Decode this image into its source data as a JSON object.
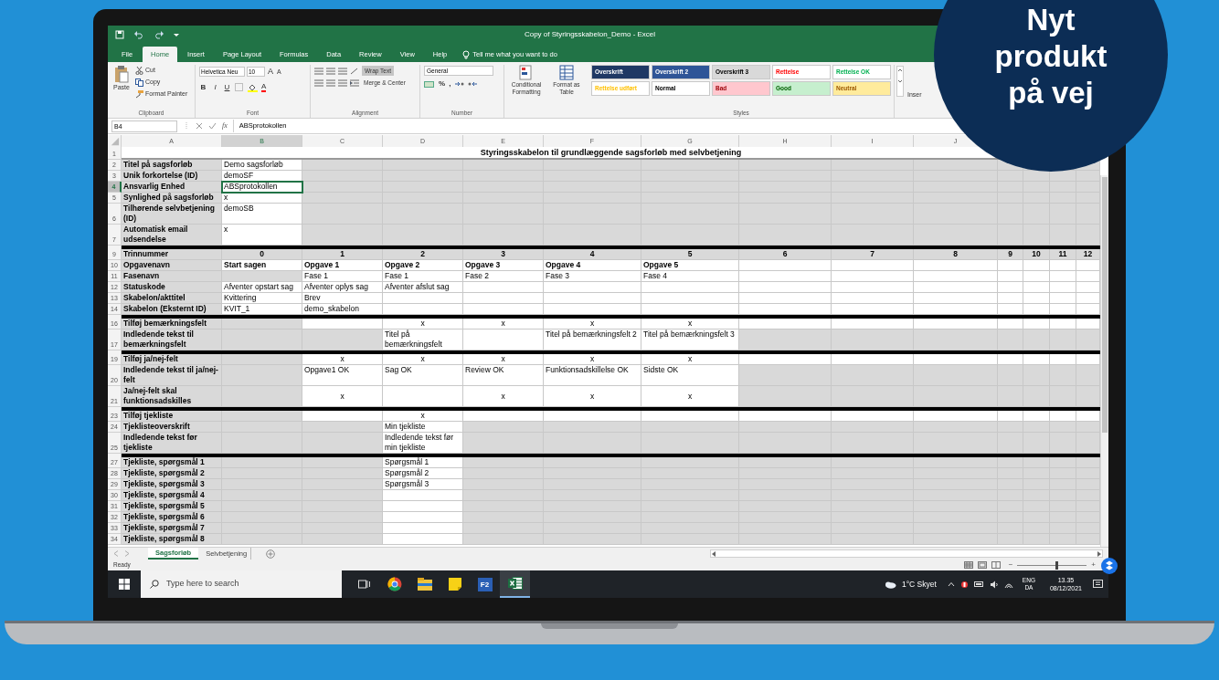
{
  "badge": {
    "text": "Nyt produkt på vej"
  },
  "title_bar": {
    "title": "Copy of Styringsskabelon_Demo  -  Excel"
  },
  "ribbon_tabs": [
    {
      "label": "File",
      "selected": false
    },
    {
      "label": "Home",
      "selected": true
    },
    {
      "label": "Insert",
      "selected": false
    },
    {
      "label": "Page Layout",
      "selected": false
    },
    {
      "label": "Formulas",
      "selected": false
    },
    {
      "label": "Data",
      "selected": false
    },
    {
      "label": "Review",
      "selected": false
    },
    {
      "label": "View",
      "selected": false
    },
    {
      "label": "Help",
      "selected": false
    }
  ],
  "tell_me": "Tell me what you want to do",
  "ribbon": {
    "clipboard": {
      "label": "Clipboard",
      "paste": "Paste",
      "cut": "Cut",
      "copy": "Copy",
      "format_painter": "Format Painter"
    },
    "font": {
      "label": "Font",
      "font_name": "Helvetica Neu",
      "font_size": "10",
      "size_buttons": [
        "A",
        "A"
      ],
      "format_buttons": [
        "B",
        "I",
        "U"
      ],
      "color_button": "A"
    },
    "alignment": {
      "label": "Alignment",
      "wrap_text": {
        "label": "Wrap Text",
        "on": true
      },
      "merge": "Merge & Center"
    },
    "number": {
      "label": "Number",
      "format": "General",
      "symbols": [
        "%",
        ","
      ]
    },
    "commands": [
      "Conditional Formatting",
      "Format as Table"
    ],
    "styles": {
      "label": "Styles",
      "tiles": [
        {
          "text": "Overskrift",
          "color": "#1f3864",
          "kind": "heading"
        },
        {
          "text": "Overskrift 2",
          "color": "#2f5597",
          "kind": "heading"
        },
        {
          "text": "Overskrift 3",
          "color": "#d9d9d9",
          "kind": "plain"
        },
        {
          "text": "Rettelse",
          "color": "#ffffff",
          "kind": "red"
        },
        {
          "text": "Rettelse OK",
          "color": "#ffffff",
          "kind": "green"
        },
        {
          "text": "Rettelse udført",
          "color": "#ffffff",
          "kind": "orange"
        },
        {
          "text": "Normal",
          "color": "#ffffff",
          "kind": "plain"
        },
        {
          "text": "Bad",
          "color": "#ffc7ce",
          "kind": "bad"
        },
        {
          "text": "Good",
          "color": "#c6efce",
          "kind": "good"
        },
        {
          "text": "Neutral",
          "color": "#ffeb9c",
          "kind": "neutral"
        }
      ]
    },
    "cut_command": "Inser"
  },
  "formula_bar": {
    "name_box": "B4",
    "fx": "fx",
    "formula": "ABSprotokollen"
  },
  "grid": {
    "columns": [
      {
        "label": "A",
        "selected": false
      },
      {
        "label": "B",
        "selected": true
      },
      {
        "label": "C",
        "selected": false
      },
      {
        "label": "D",
        "selected": false
      },
      {
        "label": "E",
        "selected": false
      },
      {
        "label": "F",
        "selected": false
      },
      {
        "label": "G",
        "selected": false
      },
      {
        "label": "H",
        "selected": false
      },
      {
        "label": "I",
        "selected": false
      },
      {
        "label": "J",
        "selected": false
      }
    ],
    "rows": [
      {
        "number": "1",
        "kind": "title",
        "selected": false,
        "text": "Styringsskabelon til grundlæggende sagsforløb med selvbetjening"
      },
      {
        "number": "2",
        "kind": "normal",
        "selected": false,
        "cells": [
          {
            "text": "Titel på sagsforløb",
            "shaded": true
          },
          {
            "text": "Demo sagsforløb",
            "shaded": false
          },
          {
            "shaded": true
          },
          {
            "shaded": true
          },
          {
            "shaded": true
          },
          {
            "shaded": true
          },
          {
            "shaded": true
          },
          {
            "shaded": true
          },
          {
            "shaded": true
          },
          {
            "shaded": true
          },
          {
            "shaded": true
          },
          {
            "shaded": true
          },
          {
            "shaded": true
          },
          {
            "shaded": true
          }
        ]
      },
      {
        "number": "3",
        "kind": "normal",
        "selected": false,
        "cells": [
          {
            "text": "Unik forkortelse (ID)",
            "shaded": true
          },
          {
            "text": "demoSF",
            "shaded": false
          },
          {
            "shaded": true
          },
          {
            "shaded": true
          },
          {
            "shaded": true
          },
          {
            "shaded": true
          },
          {
            "shaded": true
          },
          {
            "shaded": true
          },
          {
            "shaded": true
          },
          {
            "shaded": true
          },
          {
            "shaded": true
          },
          {
            "shaded": true
          },
          {
            "shaded": true
          },
          {
            "shaded": true
          }
        ]
      },
      {
        "number": "4",
        "kind": "normal",
        "selected": true,
        "cells": [
          {
            "text": "Ansvarlig Enhed",
            "shaded": true
          },
          {
            "text": "ABSprotokollen",
            "shaded": false
          },
          {
            "shaded": true
          },
          {
            "shaded": true
          },
          {
            "shaded": true
          },
          {
            "shaded": true
          },
          {
            "shaded": true
          },
          {
            "shaded": true
          },
          {
            "shaded": true
          },
          {
            "shaded": true
          },
          {
            "shaded": true
          },
          {
            "shaded": true
          },
          {
            "shaded": true
          },
          {
            "shaded": true
          }
        ]
      },
      {
        "number": "5",
        "kind": "normal",
        "selected": false,
        "cells": [
          {
            "text": "Synlighed på sagsforløb",
            "shaded": true
          },
          {
            "text": "x",
            "shaded": false
          },
          {
            "shaded": true
          },
          {
            "shaded": true
          },
          {
            "shaded": true
          },
          {
            "shaded": true
          },
          {
            "shaded": true
          },
          {
            "shaded": true
          },
          {
            "shaded": true
          },
          {
            "shaded": true
          },
          {
            "shaded": true
          },
          {
            "shaded": true
          },
          {
            "shaded": true
          },
          {
            "shaded": true
          }
        ]
      },
      {
        "number": "6",
        "kind": "normal",
        "selected": false,
        "cells": [
          {
            "text": "Tilhørende selvbetjening (ID)",
            "shaded": true
          },
          {
            "text": "demoSB",
            "shaded": false
          },
          {
            "shaded": true
          },
          {
            "shaded": true
          },
          {
            "shaded": true
          },
          {
            "shaded": true
          },
          {
            "shaded": true
          },
          {
            "shaded": true
          },
          {
            "shaded": true
          },
          {
            "shaded": true
          },
          {
            "shaded": true
          },
          {
            "shaded": true
          },
          {
            "shaded": true
          },
          {
            "shaded": true
          }
        ]
      },
      {
        "number": "7",
        "kind": "normal",
        "selected": false,
        "cells": [
          {
            "text": "Automatisk email udsendelse",
            "shaded": true
          },
          {
            "text": "x",
            "shaded": false
          },
          {
            "shaded": true
          },
          {
            "shaded": true
          },
          {
            "shaded": true
          },
          {
            "shaded": true
          },
          {
            "shaded": true
          },
          {
            "shaded": true
          },
          {
            "shaded": true
          },
          {
            "shaded": true
          },
          {
            "shaded": true
          },
          {
            "shaded": true
          },
          {
            "shaded": true
          },
          {
            "shaded": true
          }
        ]
      },
      {
        "kind": "separator"
      },
      {
        "number": "9",
        "kind": "steps",
        "selected": false,
        "cells": [
          {
            "text": "Trinnummer",
            "shaded": true
          },
          {
            "text": "0",
            "shaded": true
          },
          {
            "text": "1",
            "shaded": true
          },
          {
            "text": "2",
            "shaded": true
          },
          {
            "text": "3",
            "shaded": true
          },
          {
            "text": "4",
            "shaded": true
          },
          {
            "text": "5",
            "shaded": true
          },
          {
            "text": "6",
            "shaded": true
          },
          {
            "text": "7",
            "shaded": true
          },
          {
            "text": "8",
            "shaded": true
          },
          {
            "text": "9",
            "shaded": true
          },
          {
            "text": "10",
            "shaded": true
          },
          {
            "text": "11",
            "shaded": true
          },
          {
            "text": "12",
            "shaded": true
          }
        ]
      },
      {
        "number": "10",
        "kind": "bold",
        "selected": false,
        "cells": [
          {
            "text": "Opgavenavn",
            "shaded": true
          },
          {
            "text": "Start sagen",
            "shaded": false
          },
          {
            "text": "Opgave 1",
            "shaded": false
          },
          {
            "text": "Opgave 2",
            "shaded": false
          },
          {
            "text": "Opgave 3",
            "shaded": false
          },
          {
            "text": "Opgave 4",
            "shaded": false
          },
          {
            "text": "Opgave 5",
            "shaded": false
          },
          {
            "shaded": false
          },
          {
            "shaded": false
          },
          {
            "shaded": false
          },
          {
            "shaded": false
          },
          {
            "shaded": false
          },
          {
            "shaded": false
          },
          {
            "shaded": false
          }
        ]
      },
      {
        "number": "11",
        "kind": "normal",
        "selected": false,
        "cells": [
          {
            "text": "Fasenavn",
            "shaded": true
          },
          {
            "shaded": true
          },
          {
            "text": "Fase 1",
            "shaded": false
          },
          {
            "text": "Fase 1",
            "shaded": false
          },
          {
            "text": "Fase 2",
            "shaded": false
          },
          {
            "text": "Fase 3",
            "shaded": false
          },
          {
            "text": "Fase 4",
            "shaded": false
          },
          {
            "shaded": false
          },
          {
            "shaded": false
          },
          {
            "shaded": false
          },
          {
            "shaded": false
          },
          {
            "shaded": false
          },
          {
            "shaded": false
          },
          {
            "shaded": false
          }
        ]
      },
      {
        "number": "12",
        "kind": "normal",
        "selected": false,
        "cells": [
          {
            "text": "Statuskode",
            "shaded": true
          },
          {
            "text": "Afventer opstart sag",
            "shaded": false
          },
          {
            "text": "Afventer oplys sag",
            "shaded": false
          },
          {
            "text": "Afventer afslut sag",
            "shaded": false
          },
          {
            "shaded": false
          },
          {
            "shaded": false
          },
          {
            "shaded": false
          },
          {
            "shaded": false
          },
          {
            "shaded": false
          },
          {
            "shaded": false
          },
          {
            "shaded": false
          },
          {
            "shaded": false
          },
          {
            "shaded": false
          },
          {
            "shaded": false
          }
        ]
      },
      {
        "number": "13",
        "kind": "normal",
        "selected": false,
        "cells": [
          {
            "text": "Skabelon/akttitel",
            "shaded": true
          },
          {
            "text": "Kvittering",
            "shaded": false
          },
          {
            "text": "Brev",
            "shaded": false
          },
          {
            "shaded": false
          },
          {
            "shaded": false
          },
          {
            "shaded": false
          },
          {
            "shaded": false
          },
          {
            "shaded": false
          },
          {
            "shaded": false
          },
          {
            "shaded": false
          },
          {
            "shaded": false
          },
          {
            "shaded": false
          },
          {
            "shaded": false
          },
          {
            "shaded": false
          }
        ]
      },
      {
        "number": "14",
        "kind": "normal",
        "selected": false,
        "cells": [
          {
            "text": "Skabelon (Eksternt ID)",
            "shaded": true
          },
          {
            "text": "KVIT_1",
            "shaded": false
          },
          {
            "text": "demo_skabelon",
            "shaded": false
          },
          {
            "shaded": false
          },
          {
            "shaded": false
          },
          {
            "shaded": false
          },
          {
            "shaded": false
          },
          {
            "shaded": false
          },
          {
            "shaded": false
          },
          {
            "shaded": false
          },
          {
            "shaded": false
          },
          {
            "shaded": false
          },
          {
            "shaded": false
          },
          {
            "shaded": false
          }
        ]
      },
      {
        "kind": "separator"
      },
      {
        "number": "16",
        "kind": "normal",
        "selected": false,
        "cells": [
          {
            "text": "Tilføj bemærkningsfelt",
            "shaded": true
          },
          {
            "shaded": true
          },
          {
            "shaded": false
          },
          {
            "text": "x",
            "kind": "mark",
            "shaded": false
          },
          {
            "text": "x",
            "kind": "mark",
            "shaded": false
          },
          {
            "text": "x",
            "kind": "mark",
            "shaded": false
          },
          {
            "text": "x",
            "kind": "mark",
            "shaded": false
          },
          {
            "shaded": false
          },
          {
            "shaded": false
          },
          {
            "shaded": false
          },
          {
            "shaded": false
          },
          {
            "shaded": false
          },
          {
            "shaded": false
          },
          {
            "shaded": false
          }
        ]
      },
      {
        "number": "17",
        "kind": "normal",
        "selected": false,
        "cells": [
          {
            "text": "Indledende tekst til bemærkningsfelt",
            "shaded": true
          },
          {
            "shaded": true
          },
          {
            "shaded": true
          },
          {
            "text": "Titel på bemærkningsfelt",
            "shaded": false
          },
          {
            "shaded": false
          },
          {
            "text": "Titel på bemærkningsfelt 2",
            "shaded": false
          },
          {
            "text": "Titel på bemærkningsfelt 3",
            "shaded": false
          },
          {
            "shaded": true
          },
          {
            "shaded": true
          },
          {
            "shaded": true
          },
          {
            "shaded": true
          },
          {
            "shaded": true
          },
          {
            "shaded": true
          },
          {
            "shaded": true
          }
        ]
      },
      {
        "kind": "separator"
      },
      {
        "number": "19",
        "kind": "normal",
        "selected": false,
        "cells": [
          {
            "text": "Tilføj ja/nej-felt",
            "shaded": true
          },
          {
            "shaded": true
          },
          {
            "text": "x",
            "kind": "mark",
            "shaded": false
          },
          {
            "text": "x",
            "kind": "mark",
            "shaded": false
          },
          {
            "text": "x",
            "kind": "mark",
            "shaded": false
          },
          {
            "text": "x",
            "kind": "mark",
            "shaded": false
          },
          {
            "text": "x",
            "kind": "mark",
            "shaded": false
          },
          {
            "shaded": false
          },
          {
            "shaded": false
          },
          {
            "shaded": false
          },
          {
            "shaded": false
          },
          {
            "shaded": false
          },
          {
            "shaded": false
          },
          {
            "shaded": false
          }
        ]
      },
      {
        "number": "20",
        "kind": "normal",
        "selected": false,
        "cells": [
          {
            "text": "Indledende tekst til ja/nej-felt",
            "shaded": true
          },
          {
            "shaded": true
          },
          {
            "text": "Opgave1 OK",
            "shaded": false
          },
          {
            "text": "Sag OK",
            "shaded": false
          },
          {
            "text": "Review OK",
            "shaded": false
          },
          {
            "text": "Funktionsadskillelse OK",
            "shaded": false
          },
          {
            "text": "Sidste OK",
            "shaded": false
          },
          {
            "shaded": true
          },
          {
            "shaded": true
          },
          {
            "shaded": true
          },
          {
            "shaded": true
          },
          {
            "shaded": true
          },
          {
            "shaded": true
          },
          {
            "shaded": true
          }
        ]
      },
      {
        "number": "21",
        "kind": "normal",
        "selected": false,
        "cells": [
          {
            "text": "Ja/nej-felt skal funktionsadskilles",
            "shaded": true
          },
          {
            "shaded": true
          },
          {
            "text": "x",
            "kind": "mark",
            "shaded": false
          },
          {
            "shaded": false
          },
          {
            "text": "x",
            "kind": "mark",
            "shaded": false
          },
          {
            "text": "x",
            "kind": "mark",
            "shaded": false
          },
          {
            "text": "x",
            "kind": "mark",
            "shaded": false
          },
          {
            "shaded": true
          },
          {
            "shaded": true
          },
          {
            "shaded": true
          },
          {
            "shaded": true
          },
          {
            "shaded": true
          },
          {
            "shaded": true
          },
          {
            "shaded": true
          }
        ]
      },
      {
        "kind": "separator"
      },
      {
        "number": "23",
        "kind": "normal",
        "selected": false,
        "cells": [
          {
            "text": "Tilføj tjekliste",
            "shaded": true
          },
          {
            "shaded": true
          },
          {
            "shaded": false
          },
          {
            "text": "x",
            "kind": "mark",
            "shaded": false
          },
          {
            "shaded": false
          },
          {
            "shaded": false
          },
          {
            "shaded": false
          },
          {
            "shaded": false
          },
          {
            "shaded": false
          },
          {
            "shaded": false
          },
          {
            "shaded": false
          },
          {
            "shaded": false
          },
          {
            "shaded": false
          },
          {
            "shaded": false
          }
        ]
      },
      {
        "number": "24",
        "kind": "normal",
        "selected": false,
        "cells": [
          {
            "text": "Tjeklisteoverskrift",
            "shaded": true
          },
          {
            "shaded": true
          },
          {
            "shaded": true
          },
          {
            "text": "Min tjekliste",
            "shaded": false
          },
          {
            "shaded": true
          },
          {
            "shaded": true
          },
          {
            "shaded": true
          },
          {
            "shaded": true
          },
          {
            "shaded": true
          },
          {
            "shaded": true
          },
          {
            "shaded": true
          },
          {
            "shaded": true
          },
          {
            "shaded": true
          },
          {
            "shaded": true
          }
        ]
      },
      {
        "number": "25",
        "kind": "normal",
        "selected": false,
        "cells": [
          {
            "text": "Indledende tekst før tjekliste",
            "shaded": true
          },
          {
            "shaded": true
          },
          {
            "shaded": true
          },
          {
            "text": "Indledende tekst før min tjekliste",
            "shaded": false
          },
          {
            "shaded": true
          },
          {
            "shaded": true
          },
          {
            "shaded": true
          },
          {
            "shaded": true
          },
          {
            "shaded": true
          },
          {
            "shaded": true
          },
          {
            "shaded": true
          },
          {
            "shaded": true
          },
          {
            "shaded": true
          },
          {
            "shaded": true
          }
        ]
      },
      {
        "kind": "separator"
      },
      {
        "number": "27",
        "kind": "normal",
        "selected": false,
        "cells": [
          {
            "text": "Tjekliste, spørgsmål 1",
            "shaded": true
          },
          {
            "shaded": true
          },
          {
            "shaded": true
          },
          {
            "text": "Spørgsmål 1",
            "shaded": false
          },
          {
            "shaded": true
          },
          {
            "shaded": true
          },
          {
            "shaded": true
          },
          {
            "shaded": true
          },
          {
            "shaded": true
          },
          {
            "shaded": true
          },
          {
            "shaded": true
          },
          {
            "shaded": true
          },
          {
            "shaded": true
          },
          {
            "shaded": true
          }
        ]
      },
      {
        "number": "28",
        "kind": "normal",
        "selected": false,
        "cells": [
          {
            "text": "Tjekliste, spørgsmål 2",
            "shaded": true
          },
          {
            "shaded": true
          },
          {
            "shaded": true
          },
          {
            "text": "Spørgsmål 2",
            "shaded": false
          },
          {
            "shaded": true
          },
          {
            "shaded": true
          },
          {
            "shaded": true
          },
          {
            "shaded": true
          },
          {
            "shaded": true
          },
          {
            "shaded": true
          },
          {
            "shaded": true
          },
          {
            "shaded": true
          },
          {
            "shaded": true
          },
          {
            "shaded": true
          }
        ]
      },
      {
        "number": "29",
        "kind": "normal",
        "selected": false,
        "cells": [
          {
            "text": "Tjekliste, spørgsmål 3",
            "shaded": true
          },
          {
            "shaded": true
          },
          {
            "shaded": true
          },
          {
            "text": "Spørgsmål 3",
            "shaded": false
          },
          {
            "shaded": true
          },
          {
            "shaded": true
          },
          {
            "shaded": true
          },
          {
            "shaded": true
          },
          {
            "shaded": true
          },
          {
            "shaded": true
          },
          {
            "shaded": true
          },
          {
            "shaded": true
          },
          {
            "shaded": true
          },
          {
            "shaded": true
          }
        ]
      },
      {
        "number": "30",
        "kind": "normal",
        "selected": false,
        "cells": [
          {
            "text": "Tjekliste, spørgsmål 4",
            "shaded": true
          },
          {
            "shaded": true
          },
          {
            "shaded": true
          },
          {
            "shaded": false
          },
          {
            "shaded": true
          },
          {
            "shaded": true
          },
          {
            "shaded": true
          },
          {
            "shaded": true
          },
          {
            "shaded": true
          },
          {
            "shaded": true
          },
          {
            "shaded": true
          },
          {
            "shaded": true
          },
          {
            "shaded": true
          },
          {
            "shaded": true
          }
        ]
      },
      {
        "number": "31",
        "kind": "normal",
        "selected": false,
        "cells": [
          {
            "text": "Tjekliste, spørgsmål 5",
            "shaded": true
          },
          {
            "shaded": true
          },
          {
            "shaded": true
          },
          {
            "shaded": false
          },
          {
            "shaded": true
          },
          {
            "shaded": true
          },
          {
            "shaded": true
          },
          {
            "shaded": true
          },
          {
            "shaded": true
          },
          {
            "shaded": true
          },
          {
            "shaded": true
          },
          {
            "shaded": true
          },
          {
            "shaded": true
          },
          {
            "shaded": true
          }
        ]
      },
      {
        "number": "32",
        "kind": "normal",
        "selected": false,
        "cells": [
          {
            "text": "Tjekliste, spørgsmål 6",
            "shaded": true
          },
          {
            "shaded": true
          },
          {
            "shaded": true
          },
          {
            "shaded": false
          },
          {
            "shaded": true
          },
          {
            "shaded": true
          },
          {
            "shaded": true
          },
          {
            "shaded": true
          },
          {
            "shaded": true
          },
          {
            "shaded": true
          },
          {
            "shaded": true
          },
          {
            "shaded": true
          },
          {
            "shaded": true
          },
          {
            "shaded": true
          }
        ]
      },
      {
        "number": "33",
        "kind": "normal",
        "selected": false,
        "cells": [
          {
            "text": "Tjekliste, spørgsmål 7",
            "shaded": true
          },
          {
            "shaded": true
          },
          {
            "shaded": true
          },
          {
            "shaded": false
          },
          {
            "shaded": true
          },
          {
            "shaded": true
          },
          {
            "shaded": true
          },
          {
            "shaded": true
          },
          {
            "shaded": true
          },
          {
            "shaded": true
          },
          {
            "shaded": true
          },
          {
            "shaded": true
          },
          {
            "shaded": true
          },
          {
            "shaded": true
          }
        ]
      },
      {
        "number": "34",
        "kind": "normal",
        "selected": false,
        "cells": [
          {
            "text": "Tjekliste, spørgsmål 8",
            "shaded": true
          },
          {
            "shaded": true
          },
          {
            "shaded": true
          },
          {
            "shaded": false
          },
          {
            "shaded": true
          },
          {
            "shaded": true
          },
          {
            "shaded": true
          },
          {
            "shaded": true
          },
          {
            "shaded": true
          },
          {
            "shaded": true
          },
          {
            "shaded": true
          },
          {
            "shaded": true
          },
          {
            "shaded": true
          },
          {
            "shaded": true
          }
        ]
      }
    ]
  },
  "sheet_tabs": [
    {
      "label": "Sagsforløb",
      "selected": true
    },
    {
      "label": "Selvbetjening",
      "selected": false
    }
  ],
  "status_bar": {
    "text": "Ready",
    "zoom": {
      "minus": "−",
      "plus": "+",
      "level": 0.55
    }
  },
  "taskbar": {
    "search_placeholder": "Type here to search",
    "apps": [
      {
        "kind": "task-view",
        "selected": false
      },
      {
        "kind": "browser",
        "selected": false
      },
      {
        "kind": "folder",
        "selected": false
      },
      {
        "kind": "note",
        "selected": false
      },
      {
        "kind": "app",
        "label": "F2",
        "selected": false
      },
      {
        "kind": "spreadsheet",
        "selected": true
      }
    ],
    "weather": "1°C Skyet",
    "language": [
      "ENG",
      "DA"
    ],
    "time": "13.35",
    "date": "08/12/2021"
  }
}
